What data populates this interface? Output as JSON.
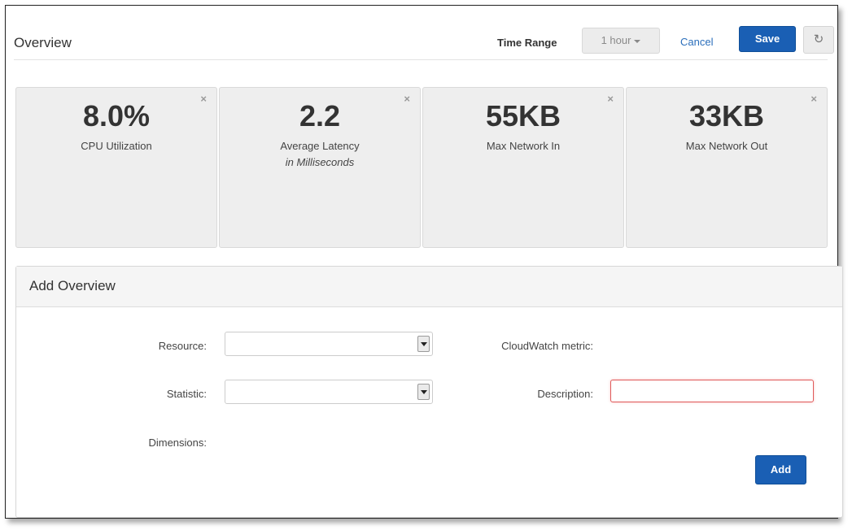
{
  "header": {
    "title": "Overview",
    "time_range_label": "Time Range",
    "time_range_value": "1 hour",
    "cancel_label": "Cancel",
    "save_label": "Save",
    "refresh_icon": "refresh-icon"
  },
  "metrics": [
    {
      "value": "8.0%",
      "label": "CPU Utilization",
      "sublabel": ""
    },
    {
      "value": "2.2",
      "label": "Average Latency",
      "sublabel": "in Milliseconds"
    },
    {
      "value": "55KB",
      "label": "Max Network In",
      "sublabel": ""
    },
    {
      "value": "33KB",
      "label": "Max Network Out",
      "sublabel": ""
    }
  ],
  "close_glyph": "×",
  "panel": {
    "title": "Add Overview",
    "resource_label": "Resource:",
    "statistic_label": "Statistic:",
    "dimensions_label": "Dimensions:",
    "cloudwatch_metric_label": "CloudWatch metric:",
    "description_label": "Description:",
    "description_value": "",
    "add_label": "Add"
  },
  "colors": {
    "primary": "#1a5fb4",
    "link": "#2a6ebb",
    "tile_bg": "#eeeeee",
    "invalid_border": "#e05a5a"
  }
}
